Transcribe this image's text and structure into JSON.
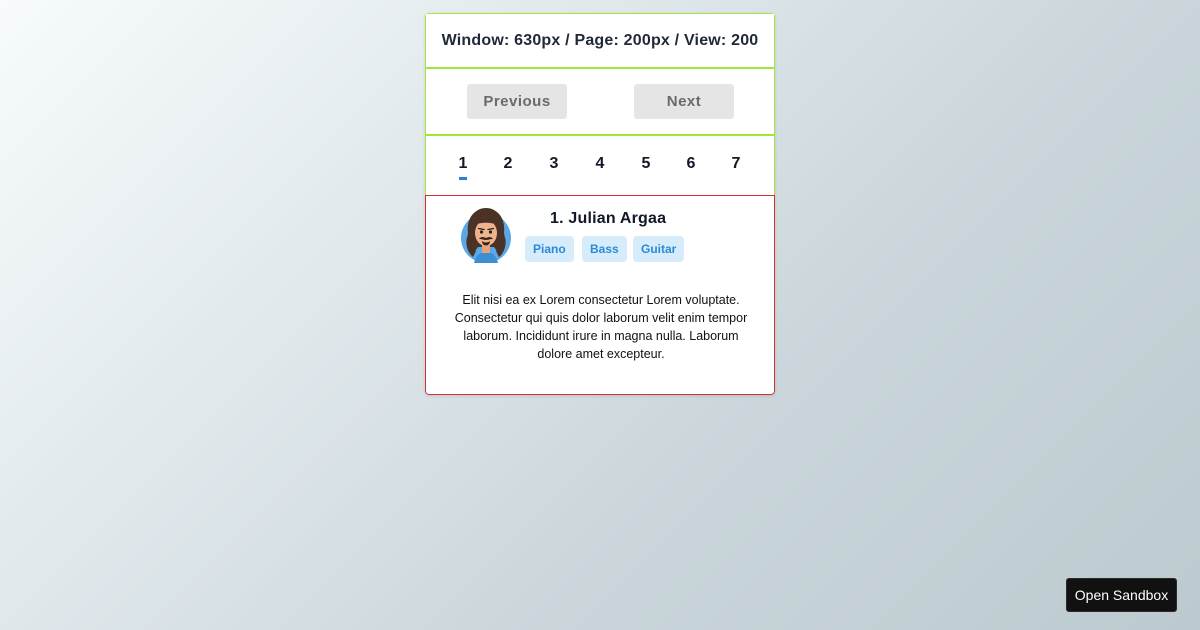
{
  "info": {
    "text": "Window: 630px / Page: 200px / View: 200"
  },
  "nav": {
    "previous": "Previous",
    "next": "Next"
  },
  "pagination": {
    "pages": [
      "1",
      "2",
      "3",
      "4",
      "5",
      "6",
      "7"
    ],
    "active": "1"
  },
  "profile": {
    "name": "1. Julian Argaa",
    "avatar_icon": "bearded-man-avatar-icon",
    "tags": [
      "Piano",
      "Bass",
      "Guitar"
    ],
    "description": "Elit nisi ea ex Lorem consectetur Lorem voluptate. Consectetur qui quis dolor laborum velit enim tempor laborum. Incididunt irure in magna nulla. Laborum dolore amet excepteur."
  },
  "sandbox": {
    "label": "Open Sandbox"
  },
  "colors": {
    "accent_green": "#a3e635",
    "accent_red": "#d32f2f",
    "tag_bg": "#d6ecfb",
    "tag_text": "#2a8ad8",
    "active_underline": "#2b7fd6"
  }
}
